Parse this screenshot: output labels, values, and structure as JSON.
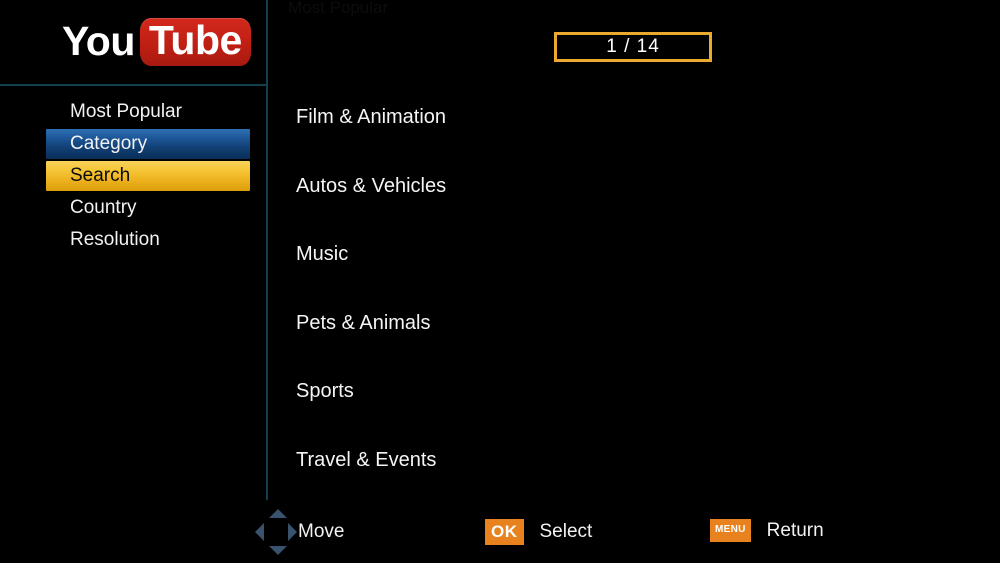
{
  "app": {
    "logo_primary": "You",
    "logo_secondary": "Tube",
    "brand_red": "#cc2118",
    "ghost_title": "Most Popular"
  },
  "page_indicator": {
    "value": "1 / 14",
    "border_color": "#eba92d"
  },
  "sidebar": {
    "items": [
      {
        "label": "Most Popular",
        "state": "normal"
      },
      {
        "label": "Category",
        "state": "selected-blue"
      },
      {
        "label": "Search",
        "state": "selected-gold"
      },
      {
        "label": "Country",
        "state": "normal"
      },
      {
        "label": "Resolution",
        "state": "normal"
      }
    ],
    "selected_blue_color": "#1f589a",
    "selected_gold_color": "#f6c639"
  },
  "main": {
    "items": [
      {
        "label": "Film & Animation"
      },
      {
        "label": "Autos & Vehicles"
      },
      {
        "label": "Music"
      },
      {
        "label": "Pets & Animals"
      },
      {
        "label": "Sports"
      },
      {
        "label": "Travel & Events"
      }
    ]
  },
  "hints": [
    {
      "icon": "dpad-icon",
      "badge": null,
      "label": "Move"
    },
    {
      "icon": "ok-button-icon",
      "badge": "OK",
      "label": "Select"
    },
    {
      "icon": "menu-button-icon",
      "badge": "MENU",
      "label": "Return"
    }
  ],
  "colors": {
    "background": "#000000",
    "divider": "#13414f",
    "badge_orange": "#e8821e",
    "dpad_arrow": "#39536e"
  }
}
